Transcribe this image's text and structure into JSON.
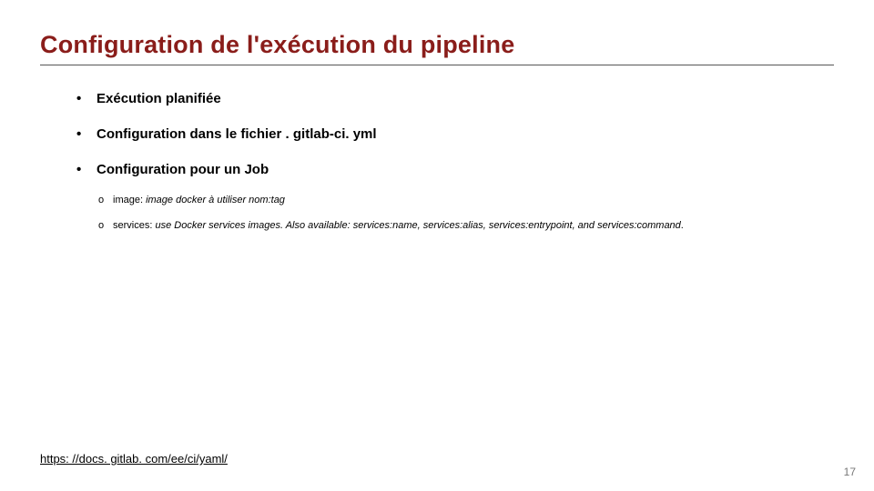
{
  "title": "Configuration de l'exécution du pipeline",
  "bullets": {
    "b1": "Exécution planifiée",
    "b2_prefix": "Configuration dans le fichier",
    "b2_file": ". gitlab-ci. yml",
    "b3": "Configuration pour un Job"
  },
  "sub": {
    "s1_lead": "image: ",
    "s1_rest": "image docker à utiliser  nom:tag",
    "s2_lead": "services: ",
    "s2_rest": "use Docker services images. Also available: services:name, services:alias, services:entrypoint, and services:command",
    "s2_suffix": "."
  },
  "footer_link": "https: //docs. gitlab. com/ee/ci/yaml/",
  "page_number": "17"
}
